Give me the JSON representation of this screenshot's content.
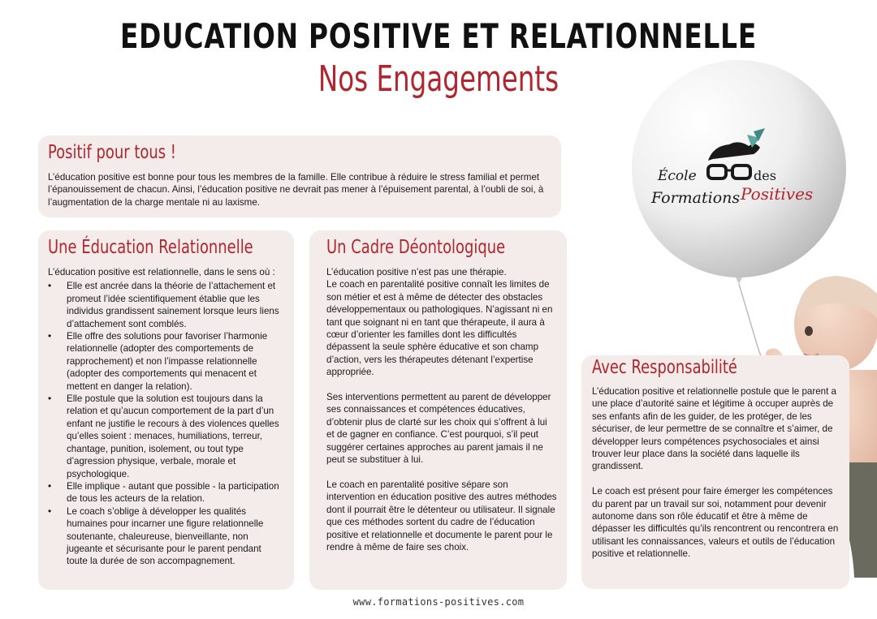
{
  "header": {
    "title": "EDUCATION POSITIVE ET RELATIONNELLE",
    "subtitle": "Nos Engagements"
  },
  "logo": {
    "line1": "École",
    "line1_right": "des",
    "line2_a": "Formations",
    "line2_b": "Positives"
  },
  "sections": {
    "positif": {
      "heading": "Positif pour tous !",
      "text": "L’éducation positive est bonne pour tous les membres de la famille. Elle contribue à réduire le stress familial et permet l’épanouissement de chacun. Ainsi, l’éducation positive ne devrait pas mener à l’épuisement parental, à l’oubli de soi, à l’augmentation de la charge mentale ni au laxisme."
    },
    "relation": {
      "heading": "Une Éducation Relationnelle",
      "intro": "L’éducation positive est relationnelle, dans le sens où :",
      "items": [
        "Elle est ancrée dans la théorie de l’attachement et promeut l’idée scientifiquement établie que les individus grandissent sainement lorsque leurs liens d’attachement sont comblés.",
        "Elle offre des solutions pour favoriser l’harmonie relationnelle (adopter des comportements de rapprochement) et non l’impasse relationnelle (adopter des comportements qui menacent et mettent en danger la relation).",
        "Elle postule que la solution est toujours dans la relation et qu’aucun comportement de la part d’un enfant ne justifie le recours à des violences quelles qu’elles soient : menaces, humiliations, terreur, chantage, punition, isolement, ou tout type d’agression physique, verbale, morale et psychologique.",
        "Elle implique - autant que possible - la participation de tous les acteurs de la relation.",
        "Le coach s’oblige à développer les qualités humaines pour incarner une figure relationnelle soutenante, chaleureuse, bienveillante, non jugeante et sécurisante pour le parent pendant toute la durée de son accompagnement."
      ]
    },
    "cadre": {
      "heading": "Un Cadre Déontologique",
      "p1": "L’éducation positive n’est pas une thérapie.",
      "p2": "Le coach en parentalité positive connaît les limites de son métier et est à même de détecter des obstacles développementaux ou pathologiques. N’agissant ni en tant que soignant ni en tant que thérapeute, il aura à cœur d’orienter les familles dont les difficultés dépassent la seule sphère éducative et son champ d’action, vers les thérapeutes détenant l’expertise appropriée.",
      "p3": "Ses interventions permettent au parent de développer ses connaissances et compétences éducatives, d’obtenir plus de clarté sur les choix qui s’offrent à lui et de gagner en confiance. C’est pourquoi, s’il peut suggérer certaines approches au parent jamais il ne peut se substituer à lui.",
      "p4": "Le coach en parentalité positive sépare son intervention en éducation positive des autres méthodes dont il pourrait être le détenteur ou utilisateur. Il signale que ces méthodes sortent du cadre de l’éducation positive et relationnelle et documente le parent pour le rendre à même de faire ses choix."
    },
    "resp": {
      "heading": "Avec Responsabilité",
      "p1": "L’éducation positive et relationnelle postule que le parent a une place d’autorité saine et légitime à occuper auprès de ses enfants afin de les guider, de les protéger, de les sécuriser, de leur permettre de se connaître et s’aimer, de développer leurs compétences psychosociales et ainsi trouver leur place dans la société dans laquelle ils grandissent.",
      "p2": "Le coach est présent pour faire émerger les compétences du parent par un travail sur soi, notamment pour devenir autonome dans son rôle éducatif et être à même de dépasser les difficultés qu’ils rencontrent ou rencontrera en utilisant les connaissances, valeurs et outils de l’éducation positive et relationnelle."
    }
  },
  "footer": {
    "website": "www.formations-positives.com"
  },
  "colors": {
    "accent": "#b1262e",
    "card": "#f4ecea",
    "hummingbird": "#5aa7a0"
  }
}
